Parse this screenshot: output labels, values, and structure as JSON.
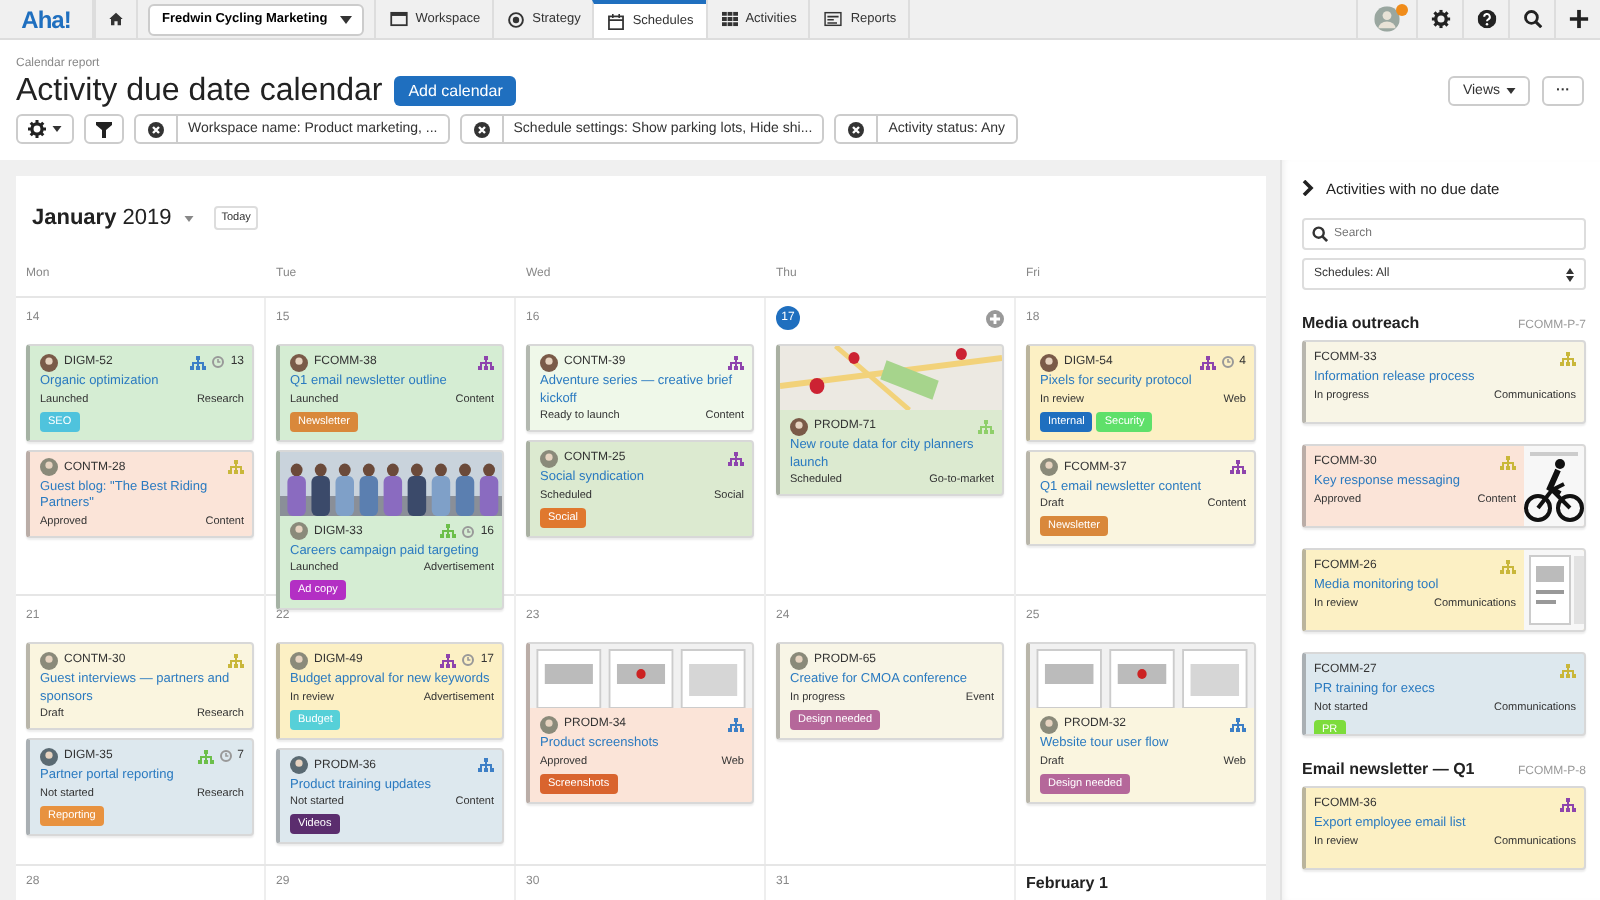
{
  "nav": {
    "logo": "Aha!",
    "workspace": "Fredwin Cycling Marketing",
    "tabs": [
      {
        "label": "Workspace",
        "selected": false
      },
      {
        "label": "Strategy",
        "selected": false
      },
      {
        "label": "Schedules",
        "selected": true
      },
      {
        "label": "Activities",
        "selected": false
      },
      {
        "label": "Reports",
        "selected": false
      }
    ],
    "notification": true
  },
  "header": {
    "breadcrumb": "Calendar report",
    "title": "Activity due date calendar",
    "add_button": "Add calendar",
    "views_button": "Views",
    "more_button": "···"
  },
  "filters": [
    {
      "label": "Workspace name: Product marketing, ..."
    },
    {
      "label": "Schedule settings: Show parking lots, Hide shi..."
    },
    {
      "label": "Activity status: Any"
    }
  ],
  "calendar": {
    "month": "January",
    "year": "2019",
    "today_button": "Today",
    "weekdays": [
      "Mon",
      "Tue",
      "Wed",
      "Thu",
      "Fri"
    ],
    "weeks": [
      {
        "days": [
          {
            "date": "14",
            "today": false,
            "cards": [
              {
                "id": "DIGM-52",
                "title": "Organic optimization",
                "status": "Launched",
                "category": "Research",
                "color": "#d5edd3",
                "icon": {
                  "color": "#3d7fc6"
                },
                "count": "13",
                "tags": [
                  {
                    "label": "SEO",
                    "color": "#4fc3dd"
                  }
                ]
              },
              {
                "id": "CONTM-28",
                "title": "Guest blog: \"The Best Riding Partners\"",
                "status": "Approved",
                "category": "Content",
                "color": "#fbe4d8",
                "icon": {
                  "color": "#c9b73a"
                }
              }
            ]
          },
          {
            "date": "15",
            "today": false,
            "cards": [
              {
                "id": "FCOMM-38",
                "title": "Q1 email newsletter outline",
                "status": "Launched",
                "category": "Content",
                "color": "#d5edd3",
                "icon": {
                  "color": "#8e44ad"
                },
                "tags": [
                  {
                    "label": "Newsletter",
                    "color": "#d9883b"
                  }
                ]
              },
              {
                "id": "DIGM-33",
                "title": "Careers campaign paid targeting",
                "status": "Launched",
                "category": "Advertisement",
                "color": "#d5edd3",
                "icon": {
                  "color": "#6cbf4a"
                },
                "count": "16",
                "picture": true,
                "tags": [
                  {
                    "label": "Ad copy",
                    "color": "#b32fc4"
                  }
                ]
              }
            ]
          },
          {
            "date": "16",
            "today": false,
            "cards": [
              {
                "id": "CONTM-39",
                "title": "Adventure series — creative brief kickoff",
                "status": "Ready to launch",
                "category": "Content",
                "color": "#eff8e9",
                "icon": {
                  "color": "#8e44ad"
                }
              },
              {
                "id": "CONTM-25",
                "title": "Social syndication",
                "status": "Scheduled",
                "category": "Social",
                "color": "#dcead0",
                "icon": {
                  "color": "#8e44ad"
                },
                "tags": [
                  {
                    "label": "Social",
                    "color": "#e0782e"
                  }
                ]
              }
            ]
          },
          {
            "date": "17",
            "today": true,
            "cards": [
              {
                "id": "PRODM-71",
                "title": "New route data for city planners launch",
                "status": "Scheduled",
                "category": "Go-to-market",
                "color": "#dcead0",
                "icon": {
                  "color": "#8fcf6a"
                },
                "picture": true
              }
            ]
          },
          {
            "date": "18",
            "today": false,
            "cards": [
              {
                "id": "DIGM-54",
                "title": "Pixels for security protocol",
                "status": "In review",
                "category": "Web",
                "color": "#fcf0c4",
                "icon": {
                  "color": "#8e44ad"
                },
                "count": "4",
                "tags": [
                  {
                    "label": "Internal",
                    "color": "#1f6fbf"
                  },
                  {
                    "label": "Security",
                    "color": "#5fe06a"
                  }
                ]
              },
              {
                "id": "FCOMM-37",
                "title": "Q1 email newsletter content",
                "status": "Draft",
                "category": "Content",
                "color": "#faf5df",
                "icon": {
                  "color": "#8e44ad"
                },
                "tags": [
                  {
                    "label": "Newsletter",
                    "color": "#d9883b"
                  }
                ]
              }
            ]
          }
        ]
      },
      {
        "days": [
          {
            "date": "21",
            "today": false,
            "cards": [
              {
                "id": "CONTM-30",
                "title": "Guest interviews — partners and sponsors",
                "status": "Draft",
                "category": "Research",
                "color": "#faf5df",
                "icon": {
                  "color": "#c9b73a"
                }
              },
              {
                "id": "DIGM-35",
                "title": "Partner portal reporting",
                "status": "Not started",
                "category": "Research",
                "color": "#dde8ee",
                "icon": {
                  "color": "#6cbf4a"
                },
                "count": "7",
                "tags": [
                  {
                    "label": "Reporting",
                    "color": "#e8923f"
                  }
                ]
              }
            ]
          },
          {
            "date": "22",
            "today": false,
            "cards": [
              {
                "id": "DIGM-49",
                "title": "Budget approval for new keywords",
                "status": "In review",
                "category": "Advertisement",
                "color": "#fcf0c4",
                "icon": {
                  "color": "#8e44ad"
                },
                "count": "17",
                "tags": [
                  {
                    "label": "Budget",
                    "color": "#56d0d8"
                  }
                ]
              },
              {
                "id": "PRODM-36",
                "title": "Product training updates",
                "status": "Not started",
                "category": "Content",
                "color": "#dde8ee",
                "icon": {
                  "color": "#3d7fc6"
                },
                "tags": [
                  {
                    "label": "Videos",
                    "color": "#5b2d6e"
                  }
                ]
              }
            ]
          },
          {
            "date": "23",
            "today": false,
            "cards": [
              {
                "id": "PRODM-34",
                "title": "Product screenshots",
                "status": "Approved",
                "category": "Web",
                "color": "#fbe4d8",
                "icon": {
                  "color": "#3d7fc6"
                },
                "picture": true,
                "tags": [
                  {
                    "label": "Screenshots",
                    "color": "#d9642e"
                  }
                ]
              }
            ]
          },
          {
            "date": "24",
            "today": false,
            "cards": [
              {
                "id": "PRODM-65",
                "title": "Creative for CMOA conference",
                "status": "In progress",
                "category": "Event",
                "color": "#f8f5e6",
                "tags": [
                  {
                    "label": "Design needed",
                    "color": "#b5679a"
                  }
                ]
              }
            ]
          },
          {
            "date": "25",
            "today": false,
            "cards": [
              {
                "id": "PRODM-32",
                "title": "Website tour user flow",
                "status": "Draft",
                "category": "Web",
                "color": "#faf5df",
                "icon": {
                  "color": "#3d7fc6"
                },
                "picture": true,
                "tags": [
                  {
                    "label": "Design needed",
                    "color": "#b5679a"
                  }
                ]
              }
            ]
          }
        ]
      },
      {
        "days": [
          {
            "date": "28",
            "today": false
          },
          {
            "date": "29",
            "today": false
          },
          {
            "date": "30",
            "today": false
          },
          {
            "date": "31",
            "today": false
          },
          {
            "date": "February 1",
            "today": false,
            "month_start": true
          }
        ]
      }
    ]
  },
  "sidebar": {
    "title": "Activities with no due date",
    "search": {
      "placeholder": "Search"
    },
    "schedule_select": "Schedules: All",
    "groups": [
      {
        "name": "Media outreach",
        "code": "FCOMM-P-7",
        "cards": [
          {
            "id": "FCOMM-33",
            "title": "Information release process",
            "status": "In progress",
            "category": "Communications",
            "color": "#f8f5e6",
            "icon": {
              "color": "#c9b73a"
            }
          },
          {
            "id": "FCOMM-30",
            "title": "Key response messaging",
            "status": "Approved",
            "category": "Content",
            "color": "#fbe4d8",
            "icon": {
              "color": "#c9b73a"
            },
            "picture": true
          },
          {
            "id": "FCOMM-26",
            "title": "Media monitoring tool",
            "status": "In review",
            "category": "Communications",
            "color": "#fcf0c4",
            "icon": {
              "color": "#c9b73a"
            },
            "picture": true
          },
          {
            "id": "FCOMM-27",
            "title": "PR training for execs",
            "status": "Not started",
            "category": "Communications",
            "color": "#dde8ee",
            "icon": {
              "color": "#c9b73a"
            },
            "tags": [
              {
                "label": "PR",
                "color": "#7ddc3c"
              }
            ]
          }
        ]
      },
      {
        "name": "Email newsletter — Q1",
        "code": "FCOMM-P-8",
        "cards": [
          {
            "id": "FCOMM-36",
            "title": "Export employee email list",
            "status": "In review",
            "category": "Communications",
            "color": "#fcf0c4",
            "icon": {
              "color": "#8e44ad"
            }
          }
        ]
      }
    ]
  }
}
